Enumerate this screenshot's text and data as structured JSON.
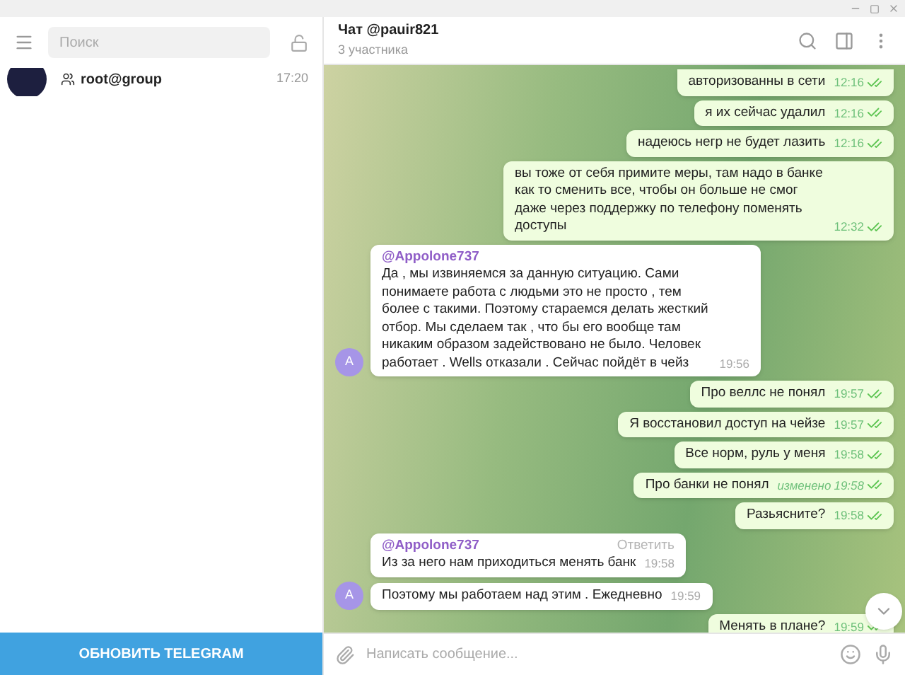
{
  "sidebar": {
    "search": {
      "placeholder": "Поиск"
    },
    "chats": [
      {
        "name": "root@group",
        "time": "17:20"
      }
    ],
    "update_button": "ОБНОВИТЬ TELEGRAM"
  },
  "chat": {
    "title": "Чат @pauir821",
    "subtitle": "3 участника"
  },
  "messages": [
    {
      "kind": "out",
      "text": "авторизованны в сети",
      "time": "12:16",
      "read": true,
      "edited": false
    },
    {
      "kind": "out",
      "text": "я их сейчас удалил",
      "time": "12:16",
      "read": true,
      "edited": false
    },
    {
      "kind": "out",
      "text": "надеюсь негр не будет лазить",
      "time": "12:16",
      "read": true,
      "edited": false
    },
    {
      "kind": "out",
      "text": "вы тоже от себя примите меры, там надо в банке как то сменить все, чтобы он больше не смог даже через поддержку по телефону поменять доступы",
      "time": "12:32",
      "read": true,
      "edited": false
    },
    {
      "kind": "in",
      "author": "@Appolone737",
      "text": "Да , мы извиняемся за данную ситуацию. Сами понимаете работа с людьми это не просто , тем более с такими. Поэтому стараемся делать жесткий отбор. Мы сделаем так , что бы его вообще там никаким образом задействовано не было. Человек работает . Wells отказали . Сейчас пойдёт в чейз",
      "time": "19:56",
      "avatar": "A"
    },
    {
      "kind": "out",
      "text": "Про веллс не понял",
      "time": "19:57",
      "read": true,
      "edited": false
    },
    {
      "kind": "out",
      "text": "Я восстановил доступ на чейзе",
      "time": "19:57",
      "read": true,
      "edited": false
    },
    {
      "kind": "out",
      "text": "Все норм, руль у меня",
      "time": "19:58",
      "read": true,
      "edited": false
    },
    {
      "kind": "out",
      "text": "Про банки не понял",
      "time": "19:58",
      "read": true,
      "edited": true,
      "edited_label": "изменено"
    },
    {
      "kind": "out",
      "text": "Разьясните?",
      "time": "19:58",
      "read": true,
      "edited": false
    },
    {
      "kind": "in",
      "author": "@Appolone737",
      "reply_label": "Ответить",
      "text": "Из за него нам приходиться менять банк",
      "time": "19:58"
    },
    {
      "kind": "in",
      "text": "Поэтому мы работаем над этим . Ежедневно",
      "time": "19:59",
      "avatar": "A"
    },
    {
      "kind": "out",
      "text": "Менять в плане?",
      "time": "19:59",
      "read": true,
      "edited": false
    }
  ],
  "composer": {
    "placeholder": "Написать сообщение..."
  }
}
